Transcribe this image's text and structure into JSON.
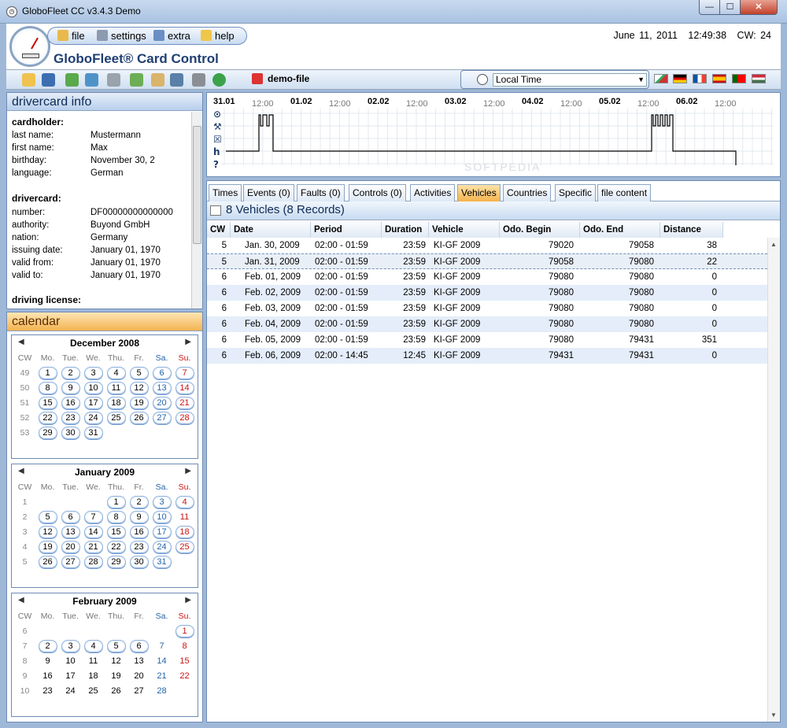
{
  "window": {
    "title": "GloboFleet CC v3.4.3 Demo",
    "min": "—",
    "max": "☐",
    "close": "✕"
  },
  "header": {
    "app_name": "GloboFleet® Card Control",
    "date": "June 11, 2011",
    "time": "12:49:38",
    "cw": "CW: 24"
  },
  "menu": {
    "file": "file",
    "settings": "settings",
    "extra": "extra",
    "help": "help"
  },
  "toolbar": {
    "file_label": "demo-file",
    "timezone": "Local Time"
  },
  "flags": [
    "#c8c8c8",
    "#000000",
    "#d9d9d9",
    "#c60b1e",
    "#006600",
    "#cd2a3e"
  ],
  "drivercard_info": {
    "title": "drivercard info",
    "cardholder_title": "cardholder:",
    "cardholder": [
      {
        "label": "last name:",
        "value": "Mustermann"
      },
      {
        "label": "first name:",
        "value": "Max"
      },
      {
        "label": "birthday:",
        "value": "November 30, 2"
      },
      {
        "label": "language:",
        "value": "German"
      }
    ],
    "drivercard_title": "drivercard:",
    "drivercard": [
      {
        "label": "number:",
        "value": "DF00000000000000"
      },
      {
        "label": "authority:",
        "value": "Buyond GmbH"
      },
      {
        "label": "nation:",
        "value": "Germany"
      },
      {
        "label": "issuing date:",
        "value": "January 01, 1970"
      },
      {
        "label": "valid from:",
        "value": "January 01, 1970"
      },
      {
        "label": "valid to:",
        "value": "January 01, 1970"
      }
    ],
    "license_title": "driving license:"
  },
  "calendar": {
    "title": "calendar",
    "headers": [
      "CW",
      "Mo.",
      "Tue.",
      "We.",
      "Thu.",
      "Fr.",
      "Sa.",
      "Su."
    ],
    "months": [
      {
        "name": "December 2008",
        "weeks": [
          {
            "cw": "49",
            "days": [
              "1",
              "2",
              "3",
              "4",
              "5",
              "6",
              "7"
            ]
          },
          {
            "cw": "50",
            "days": [
              "8",
              "9",
              "10",
              "11",
              "12",
              "13",
              "14"
            ]
          },
          {
            "cw": "51",
            "days": [
              "15",
              "16",
              "17",
              "18",
              "19",
              "20",
              "21"
            ]
          },
          {
            "cw": "52",
            "days": [
              "22",
              "23",
              "24",
              "25",
              "26",
              "27",
              "28"
            ]
          },
          {
            "cw": "53",
            "days": [
              "29",
              "30",
              "31",
              "",
              "",
              "",
              ""
            ]
          }
        ],
        "marked_through": 31
      },
      {
        "name": "January 2009",
        "weeks": [
          {
            "cw": "1",
            "days": [
              "",
              "",
              "",
              "1",
              "2",
              "3",
              "4"
            ]
          },
          {
            "cw": "2",
            "days": [
              "5",
              "6",
              "7",
              "8",
              "9",
              "10",
              "11"
            ]
          },
          {
            "cw": "3",
            "days": [
              "12",
              "13",
              "14",
              "15",
              "16",
              "17",
              "18"
            ]
          },
          {
            "cw": "4",
            "days": [
              "19",
              "20",
              "21",
              "22",
              "23",
              "24",
              "25"
            ]
          },
          {
            "cw": "5",
            "days": [
              "26",
              "27",
              "28",
              "29",
              "30",
              "31",
              ""
            ]
          }
        ],
        "marked_through": 31,
        "unmarked": [
          "11"
        ]
      },
      {
        "name": "February 2009",
        "weeks": [
          {
            "cw": "6",
            "days": [
              "",
              "",
              "",
              "",
              "",
              "",
              "1"
            ]
          },
          {
            "cw": "7",
            "days": [
              "2",
              "3",
              "4",
              "5",
              "6",
              "7",
              "8"
            ]
          },
          {
            "cw": "8",
            "days": [
              "9",
              "10",
              "11",
              "12",
              "13",
              "14",
              "15"
            ]
          },
          {
            "cw": "9",
            "days": [
              "16",
              "17",
              "18",
              "19",
              "20",
              "21",
              "22"
            ]
          },
          {
            "cw": "10",
            "days": [
              "23",
              "24",
              "25",
              "26",
              "27",
              "28",
              ""
            ]
          }
        ],
        "marked_through": 6
      }
    ]
  },
  "timeline": {
    "dates": [
      "31.01",
      "01.02",
      "02.02",
      "03.02",
      "04.02",
      "05.02",
      "06.02"
    ],
    "noon": "12:00",
    "row_icons": [
      "⊙",
      "⚒",
      "☒",
      "h",
      "?"
    ]
  },
  "tabs": [
    "Times",
    "Events (0)",
    "Faults (0)",
    "Controls (0)",
    "Activities",
    "Vehicles",
    "Countries",
    "Specific",
    "file content"
  ],
  "active_tab": "Vehicles",
  "list": {
    "title": "8 Vehicles (8 Records)",
    "columns": [
      "CW",
      "Date",
      "Period",
      "Duration",
      "Vehicle",
      "Odo. Begin",
      "Odo. End",
      "Distance"
    ],
    "rows": [
      [
        "5",
        "Jan. 30, 2009",
        "02:00 - 01:59",
        "23:59",
        "KI-GF 2009",
        "79020",
        "79058",
        "38"
      ],
      [
        "5",
        "Jan. 31, 2009",
        "02:00 - 01:59",
        "23:59",
        "KI-GF 2009",
        "79058",
        "79080",
        "22"
      ],
      [
        "6",
        "Feb. 01, 2009",
        "02:00 - 01:59",
        "23:59",
        "KI-GF 2009",
        "79080",
        "79080",
        "0"
      ],
      [
        "6",
        "Feb. 02, 2009",
        "02:00 - 01:59",
        "23:59",
        "KI-GF 2009",
        "79080",
        "79080",
        "0"
      ],
      [
        "6",
        "Feb. 03, 2009",
        "02:00 - 01:59",
        "23:59",
        "KI-GF 2009",
        "79080",
        "79080",
        "0"
      ],
      [
        "6",
        "Feb. 04, 2009",
        "02:00 - 01:59",
        "23:59",
        "KI-GF 2009",
        "79080",
        "79080",
        "0"
      ],
      [
        "6",
        "Feb. 05, 2009",
        "02:00 - 01:59",
        "23:59",
        "KI-GF 2009",
        "79080",
        "79431",
        "351"
      ],
      [
        "6",
        "Feb. 06, 2009",
        "02:00 - 14:45",
        "12:45",
        "KI-GF 2009",
        "79431",
        "79431",
        "0"
      ]
    ],
    "selected_row": 1
  },
  "watermark": "SOFTPEDIA"
}
